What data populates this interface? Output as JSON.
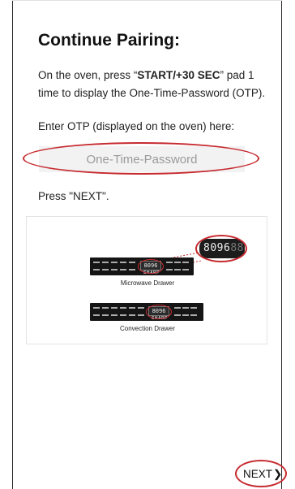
{
  "page": {
    "title": "Continue Pairing:",
    "instruction_prefix": "On the oven, press “",
    "instruction_bold": "START/+30 SEC",
    "instruction_suffix": "” pad 1 time to display the One-Time-Password (OTP).",
    "enter_label": "Enter OTP (displayed on the oven) here:",
    "otp_placeholder": "One-Time-Password",
    "otp_value": "",
    "press_next": "Press \"NEXT\"."
  },
  "figure": {
    "microwave_caption": "Microwave Drawer",
    "convection_caption": "Convection Drawer",
    "zoom_display_digits": "8096",
    "zoom_display_dim": "88",
    "microwave_display": "8096",
    "convection_display": "8096",
    "brand": "SHARP"
  },
  "footer": {
    "next_label": "NEXT",
    "next_icon": "chevron-right-icon"
  },
  "colors": {
    "highlight_ring": "#c62a2f",
    "input_background": "#f2f2f2",
    "placeholder_text": "#9a9a9a"
  }
}
